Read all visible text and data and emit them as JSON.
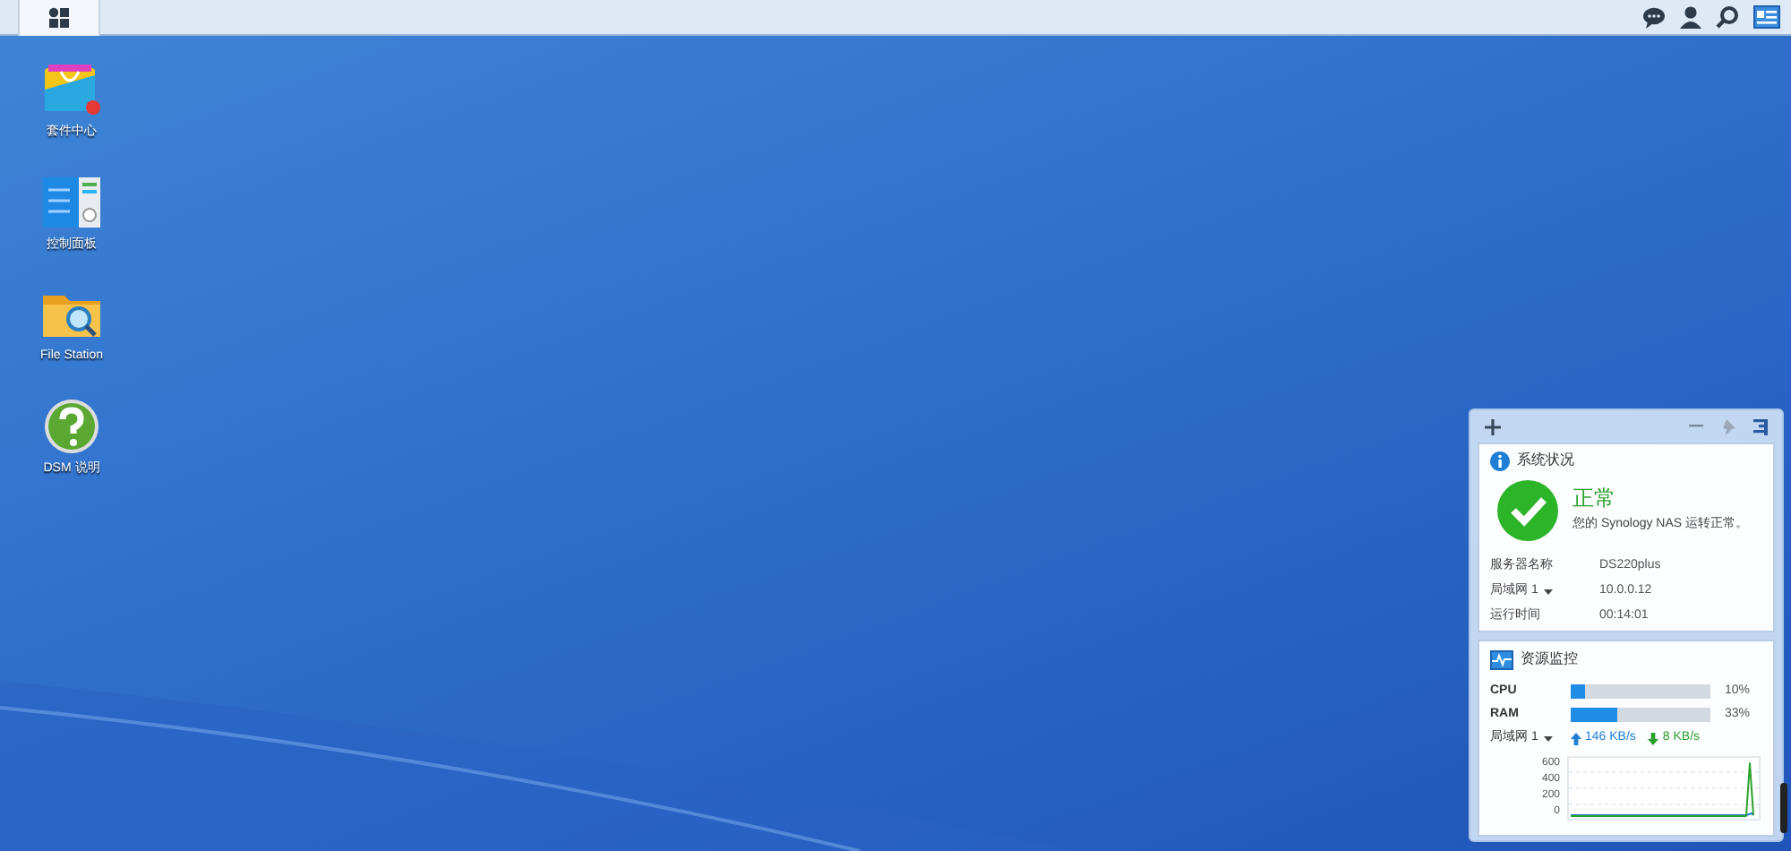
{
  "taskbar": {
    "main_menu": {
      "selected": true
    }
  },
  "desktop_icons": [
    {
      "kind": "package",
      "label": "套件中心"
    },
    {
      "kind": "control",
      "label": "控制面板"
    },
    {
      "kind": "folder",
      "label": "File Station"
    },
    {
      "kind": "help",
      "label": "DSM 说明"
    }
  ],
  "widget_panel": {
    "system_health": {
      "title": "系统状况",
      "status": "正常",
      "message": "您的 Synology NAS 运转正常。",
      "rows": [
        {
          "label": "服务器名称",
          "value": "DS220plus"
        },
        {
          "label": "局域网 1",
          "dropdown": true,
          "value": "10.0.0.12"
        },
        {
          "label": "运行时间",
          "value": "00:14:01"
        }
      ]
    },
    "resource_monitor": {
      "title": "资源监控",
      "meters": [
        {
          "label": "CPU",
          "level": 0.1,
          "reading": "10%"
        },
        {
          "label": "RAM",
          "level": 0.33,
          "reading": "33%"
        }
      ],
      "network": {
        "label": "局域网 1",
        "dropdown": true,
        "upload": "146 KB/s",
        "download": "8 KB/s"
      },
      "chart_axis": [
        "600",
        "400",
        "200",
        "0"
      ]
    }
  }
}
